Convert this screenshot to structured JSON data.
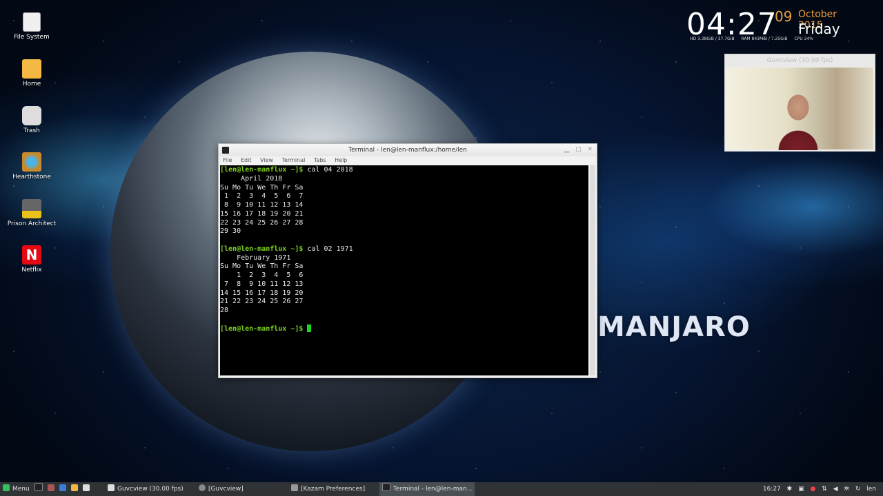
{
  "desktop": {
    "icons": [
      {
        "label": "File System",
        "icon": "drive-icon",
        "color": "#f0f0f0"
      },
      {
        "label": "Home",
        "icon": "folder-icon",
        "color": "#f4b942"
      },
      {
        "label": "Trash",
        "icon": "trash-icon",
        "color": "#dddddd"
      },
      {
        "label": "Hearthstone",
        "icon": "hearthstone-icon",
        "color": "#c98a2c"
      },
      {
        "label": "Prison Architect",
        "icon": "prison-architect-icon",
        "color": "#555555"
      },
      {
        "label": "Netflix",
        "icon": "netflix-icon",
        "color": "#e50914",
        "glyph": "N"
      }
    ],
    "brand": "MANJARO"
  },
  "clock": {
    "time": "04:27",
    "day": "09",
    "month_year": "October 2015",
    "weekday": "Friday",
    "stats": [
      "HD 3.38GiB / 37.7GiB",
      "RAM 843MiB / 7.25GiB",
      "CPU 24%"
    ]
  },
  "webcam": {
    "title": "Guvcview (30.00 fps)"
  },
  "terminal": {
    "title": "Terminal - len@len-manflux:/home/len",
    "menu": [
      "File",
      "Edit",
      "View",
      "Terminal",
      "Tabs",
      "Help"
    ],
    "prompt": "[len@len-manflux ~]$",
    "cmd1": "cal 04 2018",
    "cal1": "     April 2018\nSu Mo Tu We Th Fr Sa\n 1  2  3  4  5  6  7\n 8  9 10 11 12 13 14\n15 16 17 18 19 20 21\n22 23 24 25 26 27 28\n29 30\n",
    "cmd2": "cal 02 1971",
    "cal2": "    February 1971\nSu Mo Tu We Th Fr Sa\n    1  2  3  4  5  6\n 7  8  9 10 11 12 13\n14 15 16 17 18 19 20\n21 22 23 24 25 26 27\n28\n"
  },
  "taskbar": {
    "menu_label": "Menu",
    "tasks": [
      {
        "label": "Guvcview  (30.00 fps)",
        "active": false
      },
      {
        "label": "[Guvcview]",
        "active": false
      },
      {
        "label": "[Kazam Preferences]",
        "active": false
      },
      {
        "label": "Terminal - len@len-man...",
        "active": true
      }
    ],
    "time": "16:27",
    "user": "len"
  }
}
